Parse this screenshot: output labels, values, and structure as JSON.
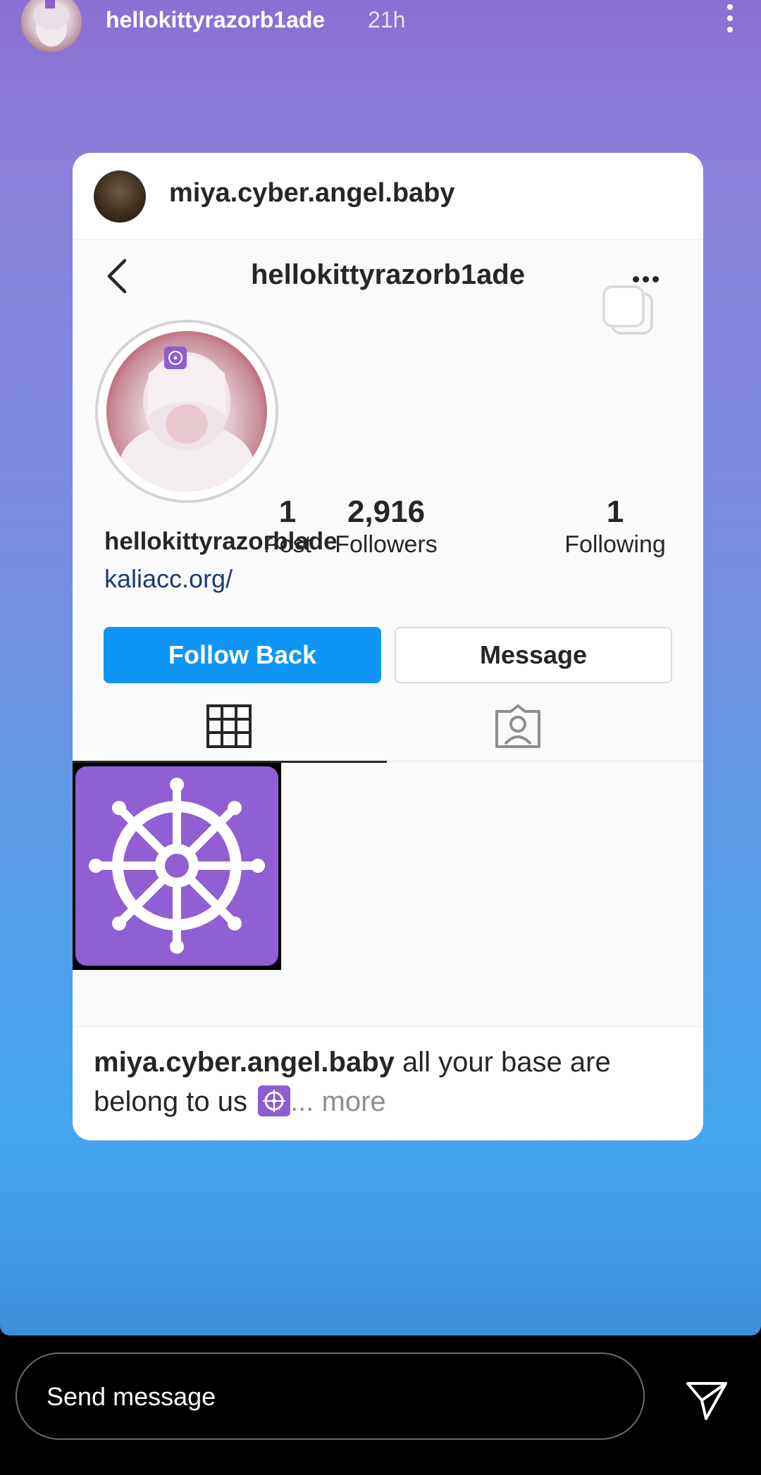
{
  "story": {
    "username": "hellokittyrazorb1ade",
    "time": "21h",
    "menu_icon": "more-vertical-icon"
  },
  "card": {
    "reposter": "miya.cyber.angel.baby",
    "profile": {
      "nav_title": "hellokittyrazorb1ade",
      "posts_count": "1",
      "posts_label": "Post",
      "followers_count": "2,916",
      "followers_label": "Followers",
      "following_count": "1",
      "following_label": "Following",
      "name": "hellokittyrazorblade",
      "link": "kaliacc.org/",
      "follow_button": "Follow Back",
      "message_button": "Message"
    },
    "caption": {
      "user": "miya.cyber.angel.baby",
      "text": " all your base are belong to us ",
      "more": "... more"
    },
    "accent_purple": "#8f5fd3",
    "accent_blue": "#0f95f6"
  },
  "reply": {
    "placeholder": "Send message",
    "send_icon": "send-paper-plane-icon"
  }
}
